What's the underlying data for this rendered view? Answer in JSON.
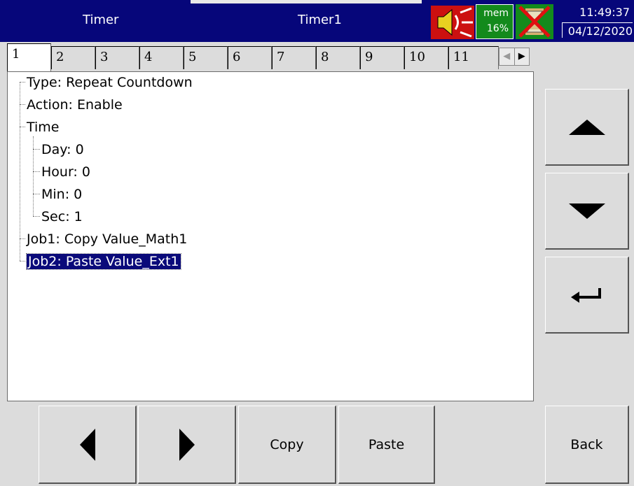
{
  "titlebar": {
    "left_title": "Timer",
    "center_title": "Timer1",
    "mem_label": "mem",
    "mem_value": "16%",
    "time": "11:49:37",
    "date": "04/12/2020"
  },
  "tabs": [
    "1",
    "2",
    "3",
    "4",
    "5",
    "6",
    "7",
    "8",
    "9",
    "10",
    "11"
  ],
  "tree": {
    "type": "Type: Repeat Countdown",
    "action": "Action: Enable",
    "time": "Time",
    "day": "Day: 0",
    "hour": "Hour: 0",
    "min": "Min: 0",
    "sec": "Sec: 1",
    "job1": "Job1: Copy Value_Math1",
    "job2": "Job2: Paste Value_Ext1"
  },
  "bottom_buttons": {
    "copy": "Copy",
    "paste": "Paste",
    "back": "Back"
  },
  "icons": [
    "speaker-icon",
    "hourglass-disabled-icon",
    "arrow-up-icon",
    "arrow-down-icon",
    "enter-icon",
    "arrow-left-icon",
    "arrow-right-icon"
  ],
  "colors": {
    "titlebar": "#06067a",
    "status_green": "#138a1c",
    "alarm_red": "#cc1010",
    "selection": "#0a0a7a"
  }
}
